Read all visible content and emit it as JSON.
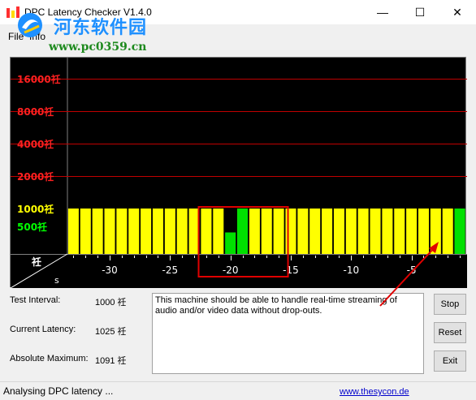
{
  "window": {
    "title": "DPC Latency Checker V1.4.0",
    "minimize_glyph": "—",
    "maximize_glyph": "☐",
    "close_glyph": "✕"
  },
  "menu": {
    "file": "File",
    "info": "Info"
  },
  "watermark": {
    "title": "河东软件园",
    "url": "www.pc0359.cn"
  },
  "chart_data": {
    "type": "bar",
    "y_scale": "log",
    "ytick_labels": [
      "16000祍",
      "8000祍",
      "4000祍",
      "2000祍",
      "1000祍",
      "500祍"
    ],
    "ytick_colors": [
      "#ff2020",
      "#ff2020",
      "#ff2020",
      "#ff2020",
      "#ffff00",
      "#00ff00"
    ],
    "xtick_labels": [
      "-30",
      "-25",
      "-20",
      "-15",
      "-10",
      "-5"
    ],
    "x_axis_unit": "s",
    "y_axis_unit": "祍",
    "x": [
      -33,
      -32,
      -31,
      -30,
      -29,
      -28,
      -27,
      -26,
      -25,
      -24,
      -23,
      -22,
      -21,
      -20,
      -19,
      -18,
      -17,
      -16,
      -15,
      -14,
      -13,
      -12,
      -11,
      -10,
      -9,
      -8,
      -7,
      -6,
      -5,
      -4,
      -3,
      -2,
      -1
    ],
    "values": [
      1000,
      1000,
      1000,
      1000,
      1000,
      1000,
      1000,
      1000,
      1000,
      1000,
      1000,
      1000,
      1000,
      0,
      1000,
      1000,
      1000,
      1000,
      1000,
      1000,
      1000,
      1000,
      1000,
      1000,
      1000,
      1000,
      1000,
      1000,
      1000,
      1000,
      1000,
      1000,
      1000
    ],
    "green_values": {
      "-20": 600,
      "-19": 1000,
      "-1": 1000
    },
    "bar_colors": {
      "ok": "#ffff00",
      "good": "#00e000",
      "warning_line": "#c00000"
    },
    "gridline_values": [
      16000,
      8000,
      4000,
      2000
    ],
    "highlight_range": [
      -22.5,
      -15.5
    ]
  },
  "stats": {
    "test_interval_label": "Test Interval:",
    "test_interval_value": "1000 祍",
    "current_latency_label": "Current Latency:",
    "current_latency_value": "1025 祍",
    "absolute_max_label": "Absolute Maximum:",
    "absolute_max_value": "1091 祍"
  },
  "message": "This machine should be able to handle real-time streaming of audio and/or video data without drop-outs.",
  "buttons": {
    "stop": "Stop",
    "reset": "Reset",
    "exit": "Exit"
  },
  "status": {
    "text": "Analysing DPC latency ...",
    "link": "www.thesycon.de"
  }
}
